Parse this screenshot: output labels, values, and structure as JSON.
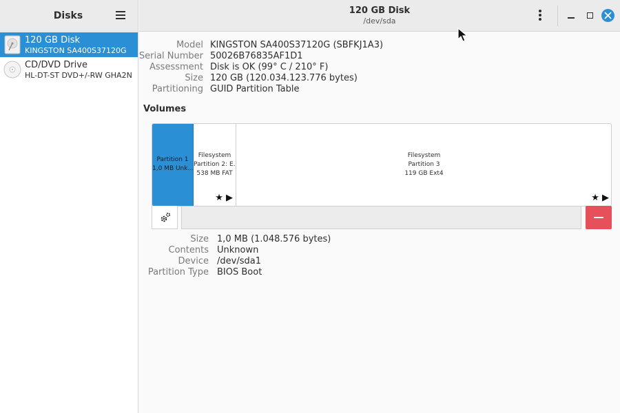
{
  "sidebar": {
    "title": "Disks",
    "drives": [
      {
        "name": "120 GB Disk",
        "model": "KINGSTON SA400S37120G",
        "icon": "hard-disk-icon",
        "selected": true
      },
      {
        "name": "CD/DVD Drive",
        "model": "HL-DT-ST DVD+/-RW GHA2N",
        "icon": "optical-drive-icon",
        "selected": false
      }
    ]
  },
  "header": {
    "title": "120 GB Disk",
    "subtitle": "/dev/sda"
  },
  "disk_info": {
    "model_label": "Model",
    "model_value": "KINGSTON SA400S37120G (SBFKJ1A3)",
    "serial_label": "Serial Number",
    "serial_value": "50026B76835AF1D1",
    "assessment_label": "Assessment",
    "assessment_value": "Disk is OK (99° C / 210° F)",
    "size_label": "Size",
    "size_value": "120 GB (120.034.123.776 bytes)",
    "partitioning_label": "Partitioning",
    "partitioning_value": "GUID Partition Table"
  },
  "volumes": {
    "title": "Volumes",
    "partitions": [
      {
        "line1": "Partition 1",
        "line2": "1,0 MB Unk…",
        "selected": true
      },
      {
        "line1": "Filesystem",
        "line2": "Partition 2: E…",
        "line3": "538 MB FAT",
        "mount_icons": "★ ▶"
      },
      {
        "line1": "Filesystem",
        "line2": "Partition 3",
        "line3": "119 GB Ext4",
        "mount_icons": "★ ▶"
      }
    ]
  },
  "partition_info": {
    "size_label": "Size",
    "size_value": "1,0 MB (1.048.576 bytes)",
    "contents_label": "Contents",
    "contents_value": "Unknown",
    "device_label": "Device",
    "device_value": "/dev/sda1",
    "type_label": "Partition Type",
    "type_value": "BIOS Boot"
  },
  "colors": {
    "accent": "#2b8fd6",
    "danger": "#e6505b"
  }
}
